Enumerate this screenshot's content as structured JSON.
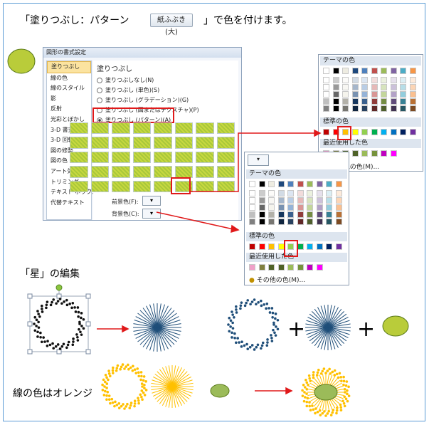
{
  "heading": {
    "prefix": "「塗りつぶし：パターン",
    "suffix": "」で色を付けます。"
  },
  "ref_button": {
    "label": "紙ふぶき (大)"
  },
  "dialog": {
    "title": "図形の書式設定",
    "sidebar": [
      "塗りつぶし",
      "線の色",
      "線のスタイル",
      "影",
      "反射",
      "光彩とぼかし",
      "3-D 書式",
      "3-D 回転",
      "図の修整",
      "図の色",
      "アート効果",
      "トリミング",
      "テキスト ボックス",
      "代替テキスト"
    ],
    "section": "塗りつぶし",
    "options": [
      "塗りつぶしなし(N)",
      "塗りつぶし (単色)(S)",
      "塗りつぶし (グラデーション)(G)",
      "塗りつぶし (図またはテクスチャ)(P)",
      "塗りつぶし (パターン)(A)"
    ],
    "fg_label": "前景色(F):",
    "bg_label": "背景色(C):"
  },
  "palette_top": {
    "theme_label": "テーマの色",
    "standard_label": "標準の色",
    "recent_label": "最近使用した色",
    "more_label": "その他の色(M)..."
  },
  "palette_bottom": {
    "theme_label": "テーマの色",
    "standard_label": "標準の色",
    "recent_label": "最近使用した色",
    "more_label": "その他の色(M)..."
  },
  "theme_top": [
    "#ffffff",
    "#000000",
    "#eeece1",
    "#1f497d",
    "#4f81bd",
    "#c0504d",
    "#9bbb59",
    "#8064a2",
    "#4bacc6",
    "#f79646"
  ],
  "standard": [
    "#c00000",
    "#ff0000",
    "#ffc000",
    "#ffff00",
    "#92d050",
    "#00b050",
    "#00b0f0",
    "#0070c0",
    "#002060",
    "#7030a0"
  ],
  "recent": [
    "#f0a0c8",
    "#7f7f3f",
    "#4f6228",
    "#4f6228",
    "#9bbb59",
    "#76923c",
    "#c000c0",
    "#ff00ff"
  ],
  "star_section": "「星」の編集",
  "orange_caption": "線の色はオレンジ",
  "colors": {
    "green": "#9bbb59",
    "yellowgreen": "#b9cc3a",
    "blue": "#1f4e79",
    "orange": "#ffc000",
    "red": "#e0191a",
    "accent": "#5b9bd5"
  }
}
